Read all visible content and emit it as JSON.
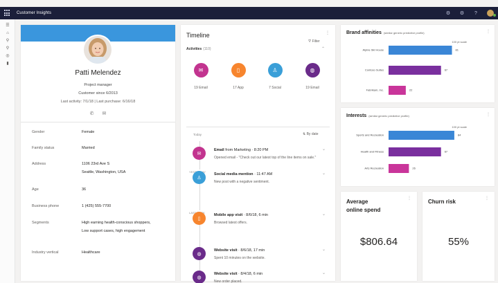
{
  "app": {
    "title": "Customer Insights"
  },
  "profile": {
    "name": "Patti Melendez",
    "role": "Project manager",
    "customer_since": "Customer since 6/2013",
    "last_activity": "Last activity: 7/1/18  |  Last purchase: 6/16/18",
    "fields": [
      {
        "label": "Gender",
        "value": [
          "Female"
        ]
      },
      {
        "label": "Family status",
        "value": [
          "Married"
        ]
      },
      {
        "label": "Address",
        "value": [
          "1106 23rd Ave S",
          "Seattle, Washington, USA"
        ]
      },
      {
        "label": "Age",
        "value": [
          "36"
        ]
      },
      {
        "label": "Business phone",
        "value": [
          "1 (425) 555-7700"
        ]
      },
      {
        "label": "Segments",
        "value": [
          "High earning health-conscious shoppers,",
          "Low support cases, high engagement"
        ]
      },
      {
        "label": "Industry vertical",
        "value": [
          "Healthcare"
        ]
      }
    ]
  },
  "timeline": {
    "title": "Timeline",
    "activities_label": "Activities",
    "activities_count": "(110)",
    "filter_label": "Filter",
    "stats": [
      {
        "label": "19 Email",
        "color": "#c2348f",
        "icon": "envelope-icon"
      },
      {
        "label": "17 App",
        "color": "#f7852e",
        "icon": "phone-icon"
      },
      {
        "label": "7 Social",
        "color": "#3a9fd8",
        "icon": "people-icon"
      },
      {
        "label": "19 Email",
        "color": "#6a2b8a",
        "icon": "globe-icon"
      }
    ],
    "today_label": "Today",
    "by_date_label": "By date",
    "yesterday_label": "YESTERDAY",
    "last_week_label": "LAST WEEK",
    "items": [
      {
        "title_bold": "Email",
        "title_rest": " from Marketing  ·  8:20 PM",
        "desc": "Opened email - \"Check out our latest top of the line items on sale.\"",
        "color": "#c2348f",
        "icon": "envelope-icon"
      },
      {
        "title_bold": "Social media mention",
        "title_rest": "  ·  11:47 AM",
        "desc": "New post with a negative sentiment.",
        "color": "#3a9fd8",
        "icon": "people-icon"
      },
      {
        "title_bold": "Mobile app visit",
        "title_rest": "  ·  8/6/18, 6 min",
        "desc": "Browsed latest offers.",
        "color": "#f7852e",
        "icon": "phone-icon"
      },
      {
        "title_bold": "Website visit",
        "title_rest": "  ·  8/6/18, 17 min",
        "desc": "Spent 10 minutes on the website.",
        "color": "#6a2b8a",
        "icon": "globe-icon"
      },
      {
        "title_bold": "Website visit",
        "title_rest": "  ·  8/4/18, 6 min",
        "desc": "New order placed.",
        "color": "#6a2b8a",
        "icon": "globe-icon"
      }
    ]
  },
  "brand_affinities": {
    "title": "Brand affinities",
    "hint": "(similar generic predictive profile)",
    "scale_label": "100 pt scale",
    "chart_data": {
      "type": "bar",
      "orientation": "horizontal",
      "categories": [
        "Alpine Ski House",
        "Contoso Suites",
        "Fabrikam, Inc."
      ],
      "values": [
        81,
        67,
        22
      ],
      "colors": [
        "#3a86d6",
        "#7a2f9e",
        "#c9359a"
      ],
      "xlim": [
        0,
        100
      ]
    }
  },
  "interests": {
    "title": "Interests",
    "hint": "(similar generic predictive profile)",
    "scale_label": "100 pt scale",
    "chart_data": {
      "type": "bar",
      "orientation": "horizontal",
      "categories": [
        "Sports and Recreation",
        "Health and Fitness",
        "Arts Recreation"
      ],
      "values": [
        84,
        67,
        26
      ],
      "colors": [
        "#3a86d6",
        "#7a2f9e",
        "#c9359a"
      ],
      "xlim": [
        0,
        100
      ]
    }
  },
  "metrics": {
    "spend_title_line1": "Average",
    "spend_title_line2": "online spend",
    "spend_value": "$806.64",
    "churn_title": "Churn risk",
    "churn_value": "55%"
  }
}
